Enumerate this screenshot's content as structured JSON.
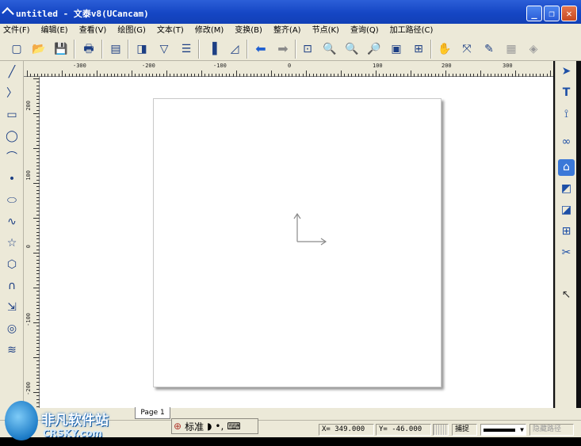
{
  "titlebar": {
    "title": "untitled - 文泰v8(UCancam)"
  },
  "menu": [
    "文件(F)",
    "编辑(E)",
    "查看(V)",
    "绘图(G)",
    "文本(T)",
    "修改(M)",
    "变换(B)",
    "整齐(A)",
    "节点(K)",
    "查询(Q)",
    "加工路径(C)"
  ],
  "ruler": {
    "h_labels": [
      "-300",
      "-200",
      "-100",
      "0",
      "100",
      "200",
      "300"
    ],
    "v_labels": [
      "200",
      "100",
      "0",
      "-100",
      "-200"
    ]
  },
  "page_tab": "Page 1",
  "ime": {
    "label": "标准"
  },
  "status": {
    "x": "X= 349.000",
    "y": "Y= -46.000",
    "snap": "捕捉",
    "hide_path": "隐藏路径"
  },
  "watermark": {
    "brand": "非凡软件站",
    "domain": "CRSKY.com"
  },
  "colors": {
    "title_bg": "#1a4cc8",
    "chrome": "#ece9d8",
    "canvas": "#ffffff"
  }
}
